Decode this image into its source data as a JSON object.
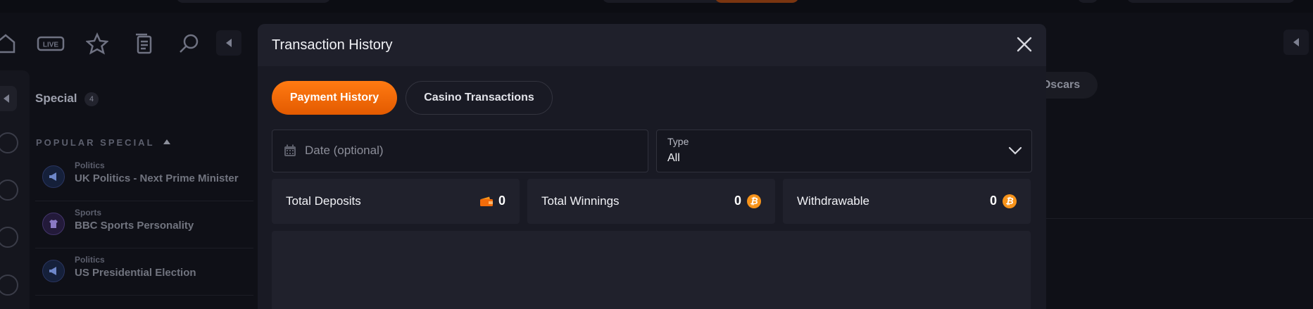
{
  "background": {
    "sidebar": {
      "section_title": "Special",
      "section_count": "4",
      "popular_heading": "POPULAR SPECIAL",
      "markets": [
        {
          "category": "Politics",
          "name": "UK Politics - Next Prime Minister"
        },
        {
          "category": "Sports",
          "name": "BBC Sports Personality"
        },
        {
          "category": "Politics",
          "name": "US Presidential Election"
        }
      ]
    },
    "nav_icons": [
      "home-icon",
      "live-icon",
      "star-icon",
      "betslip-icon",
      "search-icon"
    ],
    "live_label": "LIVE",
    "chip_label": "Oscars"
  },
  "modal": {
    "title": "Transaction History",
    "tabs": [
      {
        "label": "Payment History",
        "active": true
      },
      {
        "label": "Casino Transactions",
        "active": false
      }
    ],
    "date_field": {
      "placeholder": "Date (optional)"
    },
    "type_field": {
      "label": "Type",
      "value": "All"
    },
    "stats": [
      {
        "label": "Total Deposits",
        "value": "0",
        "icon": "wallet-icon"
      },
      {
        "label": "Total Winnings",
        "value": "0",
        "icon": "bitcoin-icon"
      },
      {
        "label": "Withdrawable",
        "value": "0",
        "icon": "bitcoin-icon"
      }
    ]
  },
  "colors": {
    "accent": "#f26b0a",
    "coin": "#f7931a",
    "modal_bg": "#191a24"
  }
}
